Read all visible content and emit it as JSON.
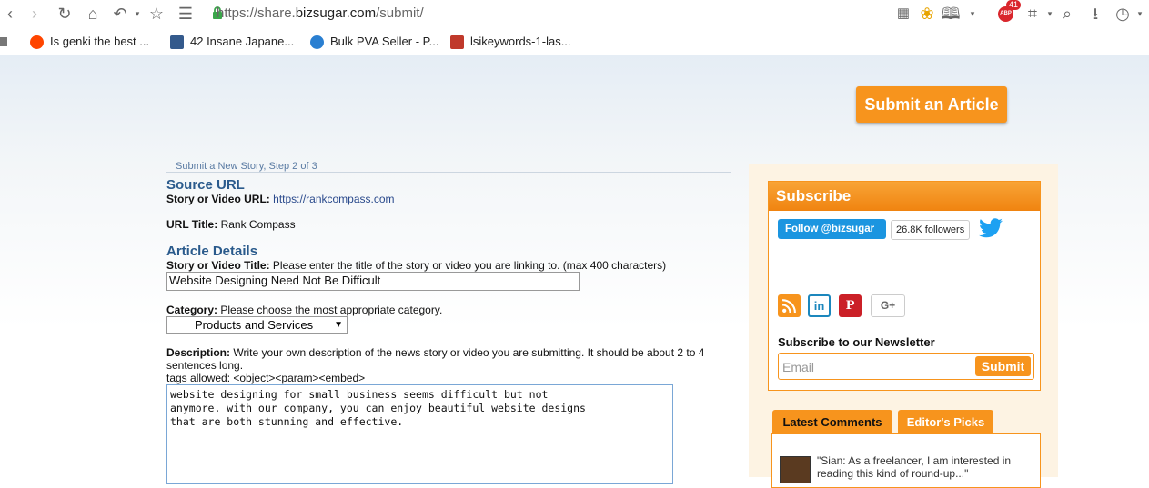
{
  "browser": {
    "url_prefix": "https://share.",
    "url_domain": "bizsugar.com",
    "url_suffix": "/submit/",
    "abp_badge": "41",
    "bookmarks": [
      {
        "label": "Is genki the best ...",
        "color": "#e6483b"
      },
      {
        "label": "42 Insane Japane...",
        "color": "#345a8c"
      },
      {
        "label": "Bulk PVA Seller - P...",
        "color": "#2a7fd1"
      },
      {
        "label": "lsikeywords-1-las...",
        "color": "#c0392b"
      }
    ]
  },
  "page": {
    "submit_article_label": "Submit an Article",
    "step_text": "Submit a New Story, Step 2 of 3",
    "source": {
      "heading": "Source URL",
      "url_label": "Story or Video URL:",
      "url_value": "https://rankcompass.com",
      "title_label": "URL Title:",
      "title_value": "Rank Compass"
    },
    "details": {
      "heading": "Article Details",
      "title_label": "Story or Video Title:",
      "title_hint": "Please enter the title of the story or video you are linking to. (max 400 characters)",
      "title_value": "Website Designing Need Not Be Difficult",
      "category_label": "Category:",
      "category_hint": "Please choose the most appropriate category.",
      "category_value": "Products and Services",
      "desc_label": "Description:",
      "desc_hint_1": "Write your own description of the news story or video you are submitting. It should be about 2 to 4",
      "desc_hint_2": "sentences long.",
      "tags_allowed": "tags allowed: <object><param><embed>",
      "desc_value": "website designing for small business seems difficult but not\nanymore. with our company, you can enjoy beautiful website designs\nthat are both stunning and effective."
    }
  },
  "sidebar": {
    "subscribe_title": "Subscribe",
    "follow_label": "Follow @bizsugar",
    "followers": "26.8K followers",
    "newsletter_label": "Subscribe to our Newsletter",
    "email_placeholder": "Email",
    "submit_label": "Submit",
    "tabs": [
      "Latest Comments",
      "Editor's Picks"
    ],
    "comment": "\"Sian: As a freelancer, I am interested in reading this kind of round-up...\""
  }
}
